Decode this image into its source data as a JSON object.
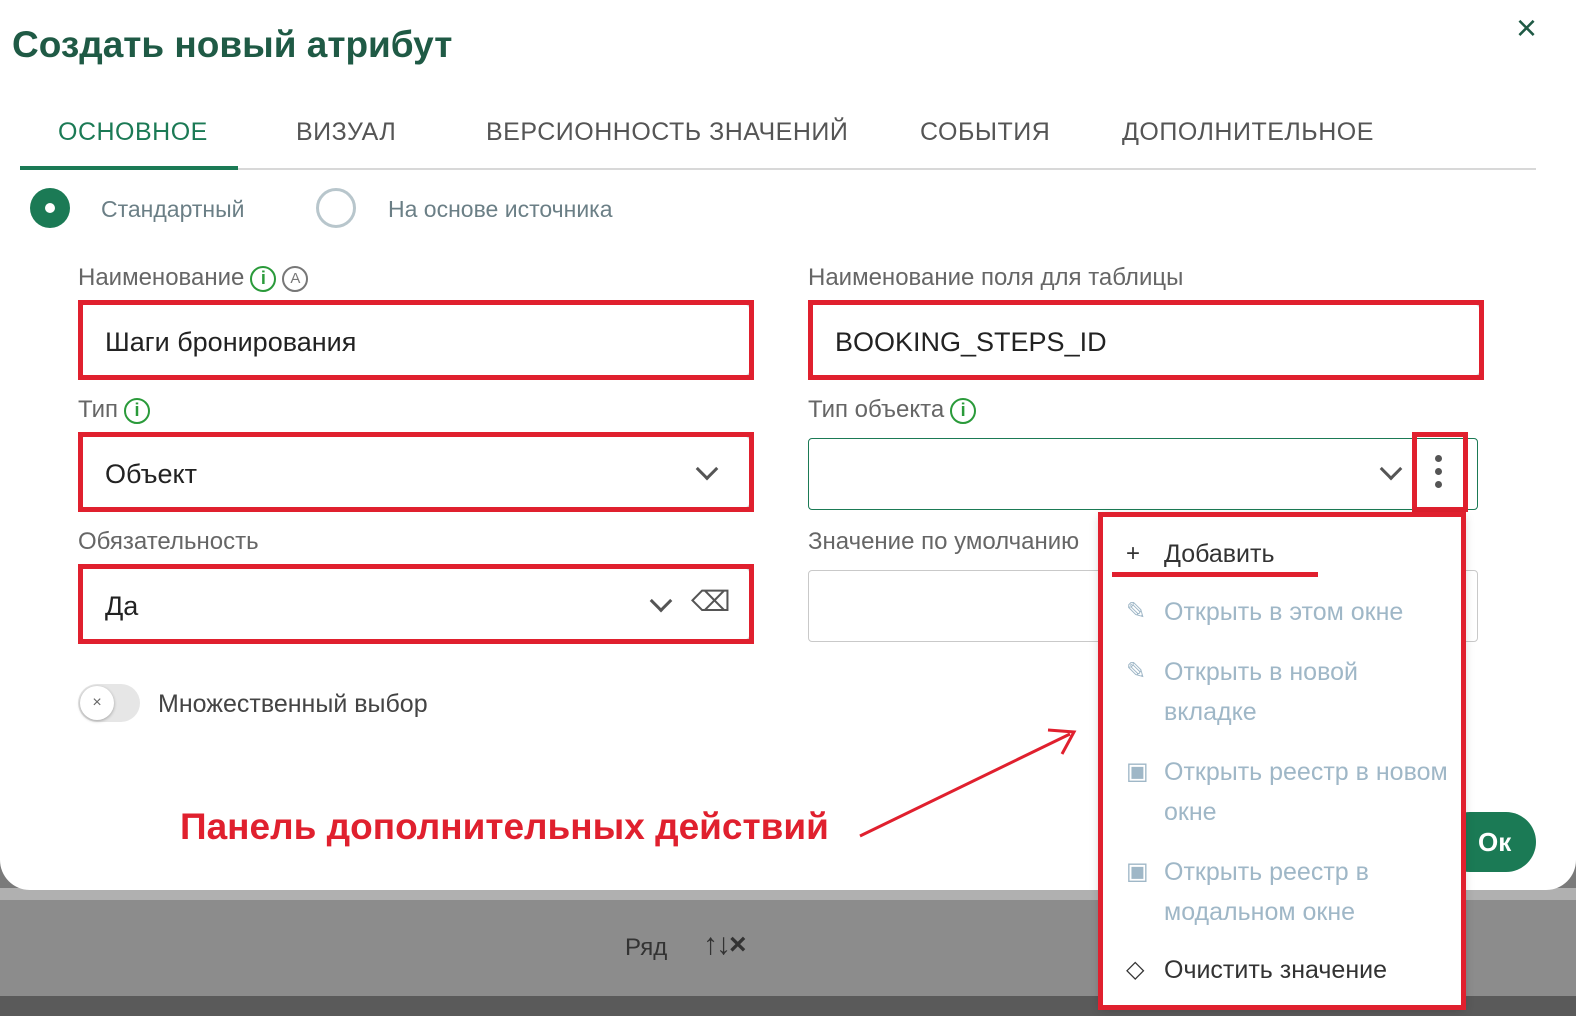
{
  "dialog": {
    "title": "Создать новый атрибут",
    "close_icon": "×"
  },
  "tabs": [
    {
      "label": "ОСНОВНОЕ",
      "active": true
    },
    {
      "label": "ВИЗУАЛ",
      "active": false
    },
    {
      "label": "ВЕРСИОННОСТЬ ЗНАЧЕНИЙ",
      "active": false
    },
    {
      "label": "СОБЫТИЯ",
      "active": false
    },
    {
      "label": "ДОПОЛНИТЕЛЬНОЕ",
      "active": false
    }
  ],
  "mode": {
    "options": [
      {
        "label": "Стандартный",
        "checked": true
      },
      {
        "label": "На основе источника",
        "checked": false
      }
    ]
  },
  "fields": {
    "name": {
      "label": "Наименование",
      "value": "Шаги бронирования",
      "info_icon": "i",
      "auto_icon": "A"
    },
    "table_field": {
      "label": "Наименование поля для таблицы",
      "value": "BOOKING_STEPS_ID"
    },
    "type": {
      "label": "Тип",
      "value": "Объект",
      "info_icon": "i"
    },
    "object_type": {
      "label": "Тип объекта",
      "value": "",
      "info_icon": "i"
    },
    "required": {
      "label": "Обязательность",
      "value": "Да"
    },
    "default_value": {
      "label": "Значение по умолчанию",
      "value": ""
    }
  },
  "multiple_choice": {
    "label": "Множественный выбор",
    "enabled": false,
    "knob_icon": "×"
  },
  "actions_menu": {
    "items": [
      {
        "icon": "+",
        "label": "Добавить",
        "enabled": true
      },
      {
        "icon": "✎",
        "label": "Открыть в этом окне",
        "enabled": false
      },
      {
        "icon": "✎",
        "label": "Открыть в новой вкладке",
        "enabled": false
      },
      {
        "icon": "▣",
        "label": "Открыть реестр в новом окне",
        "enabled": false
      },
      {
        "icon": "▣",
        "label": "Открыть реестр в модальном окне",
        "enabled": false
      },
      {
        "icon": "◇",
        "label": "Очистить значение",
        "enabled": true
      }
    ]
  },
  "annotation": {
    "text": "Панель дополнительных действий"
  },
  "buttons": {
    "ok_label": "Ок"
  },
  "background": {
    "row_label": "Ряд",
    "row_icons": "↑↓×"
  },
  "colors": {
    "accent": "#1b7a55",
    "annotation": "#e0202e",
    "info": "#2a9a3a"
  }
}
